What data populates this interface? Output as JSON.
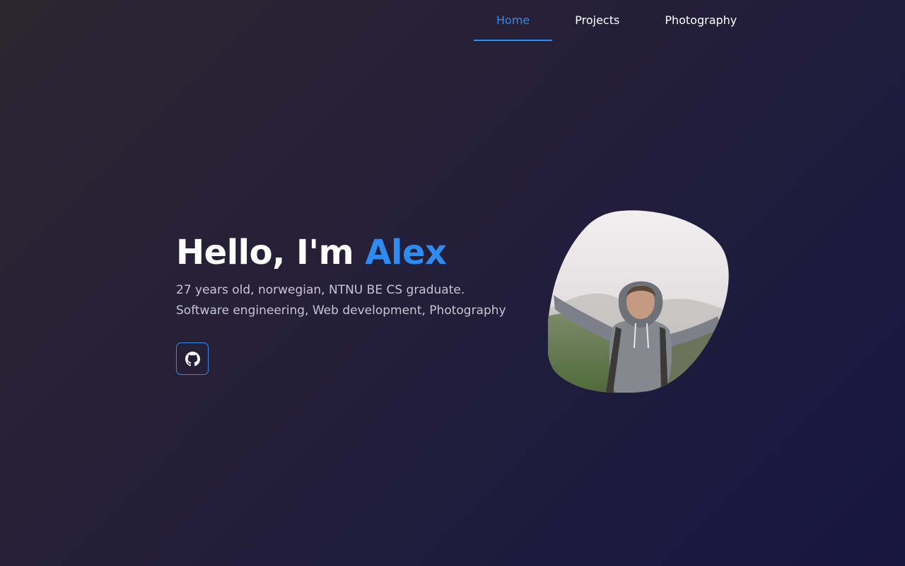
{
  "nav": {
    "items": [
      {
        "label": "Home",
        "active": true
      },
      {
        "label": "Projects",
        "active": false
      },
      {
        "label": "Photography",
        "active": false
      }
    ]
  },
  "hero": {
    "greeting": "Hello, I'm ",
    "name": "Alex",
    "description_line1": "27 years old, norwegian, NTNU BE CS graduate.",
    "description_line2": "Software engineering, Web development, Photography"
  },
  "social": {
    "github_icon": "github-icon"
  },
  "colors": {
    "accent": "#2e8bf0",
    "text": "#ffffff",
    "muted_text": "#c7c5d4",
    "background_start": "#2c2630",
    "background_end": "#17163f"
  },
  "portrait": {
    "shape": "blob"
  }
}
